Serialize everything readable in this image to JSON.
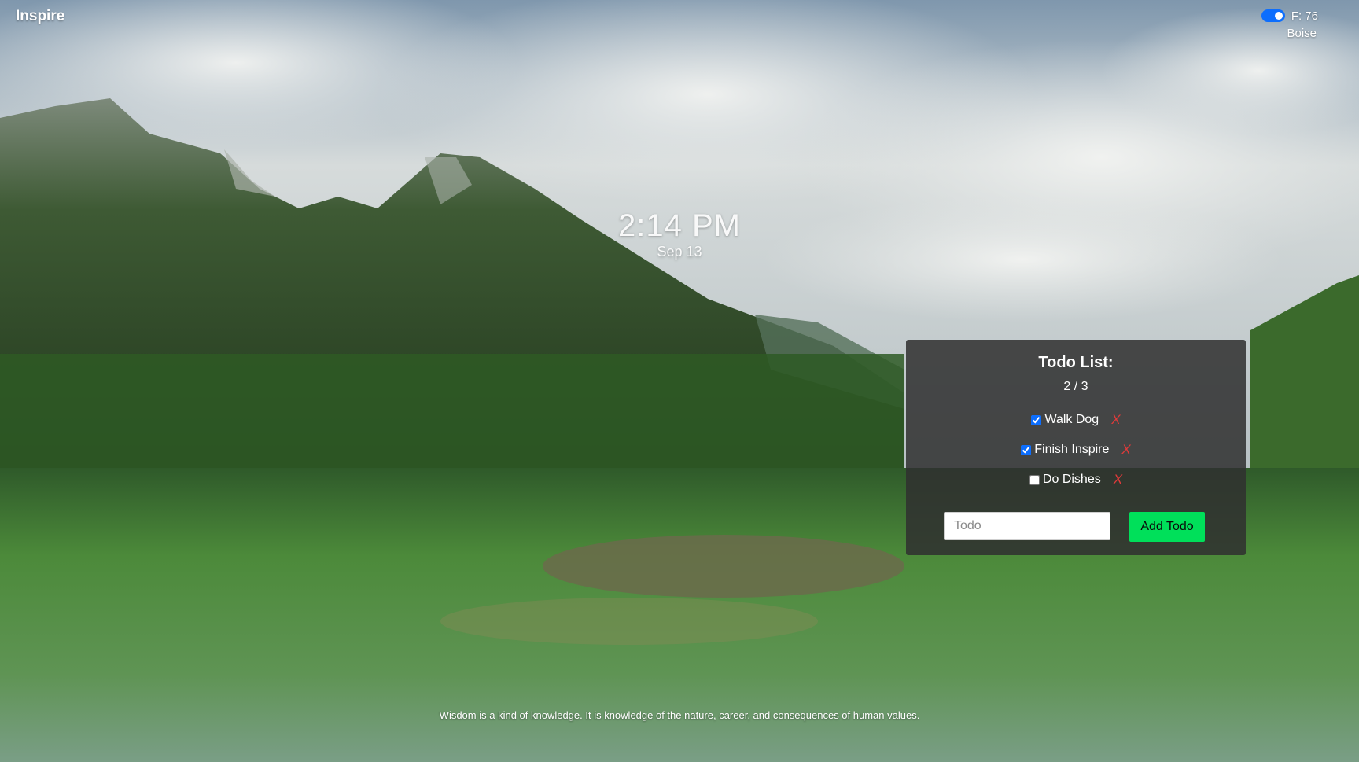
{
  "app": {
    "title": "Inspire"
  },
  "weather": {
    "unit_toggle_on": true,
    "temperature": "F: 76",
    "city": "Boise"
  },
  "clock": {
    "time": "2:14 PM",
    "date": "Sep 13"
  },
  "todo": {
    "title": "Todo List:",
    "count": "2 / 3",
    "items": [
      {
        "label": "Walk Dog",
        "done": true,
        "delete_label": "X"
      },
      {
        "label": "Finish Inspire",
        "done": true,
        "delete_label": "X"
      },
      {
        "label": "Do Dishes",
        "done": false,
        "delete_label": "X"
      }
    ],
    "input_placeholder": "Todo",
    "add_button_label": "Add Todo"
  },
  "quote": {
    "text": "Wisdom is a kind of knowledge. It is knowledge of the nature, career, and consequences of human values."
  },
  "colors": {
    "toggle": "#0d6efd",
    "add_button": "#00e05a",
    "delete_x": "#e03a3a",
    "panel": "#303030"
  },
  "background": {
    "description_icon": "mountain-lake-photo"
  }
}
